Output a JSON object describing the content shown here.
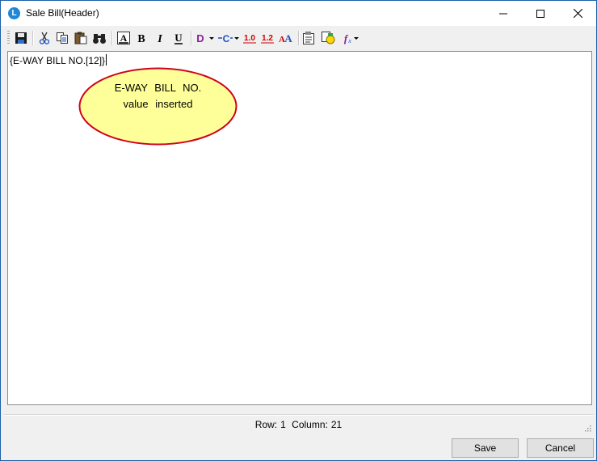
{
  "window": {
    "title": "Sale Bill(Header)",
    "app_icon_letter": "L"
  },
  "toolbar": {
    "buttons": [
      {
        "name": "save-file",
        "icon": "floppy-disk-icon"
      },
      {
        "name": "cut",
        "icon": "scissors-icon"
      },
      {
        "name": "copy",
        "icon": "copy-icon"
      },
      {
        "name": "paste",
        "icon": "clipboard-icon"
      },
      {
        "name": "find",
        "icon": "binoculars-icon"
      },
      {
        "name": "font-color",
        "icon": "font-color-icon",
        "glyph": "A"
      },
      {
        "name": "bold",
        "icon": "bold-icon",
        "glyph": "B"
      },
      {
        "name": "italic",
        "icon": "italic-icon",
        "glyph": "I"
      },
      {
        "name": "underline",
        "icon": "underline-icon",
        "glyph": "U"
      },
      {
        "name": "field-d",
        "icon": "field-d-icon",
        "glyph": "D"
      },
      {
        "name": "field-c",
        "icon": "field-c-icon",
        "glyph": "C"
      },
      {
        "name": "decimal-10",
        "icon": "decimal-one-icon",
        "glyph": "1.0"
      },
      {
        "name": "decimal-12",
        "icon": "decimal-two-icon",
        "glyph": "1.2"
      },
      {
        "name": "case",
        "icon": "case-icon",
        "glyph": "AA"
      },
      {
        "name": "properties",
        "icon": "properties-icon"
      },
      {
        "name": "insert-field",
        "icon": "insert-field-icon"
      },
      {
        "name": "function",
        "icon": "function-icon",
        "glyph": "fx"
      }
    ]
  },
  "editor": {
    "content": "{E-WAY BILL NO.[12]}",
    "callout": {
      "line1": "E-WAY BILL NO.",
      "line2": "value inserted"
    }
  },
  "status": {
    "row_label": "Row:",
    "row_value": "1",
    "column_label": "Column:",
    "column_value": "21"
  },
  "buttons": {
    "save": "Save",
    "cancel": "Cancel"
  },
  "colors": {
    "accent": "#1c5fa8",
    "callout_fill": "#ffff99",
    "callout_border": "#d0021b",
    "purple": "#8a1e9a",
    "red": "#cc0000",
    "blue": "#1f4fbf"
  }
}
